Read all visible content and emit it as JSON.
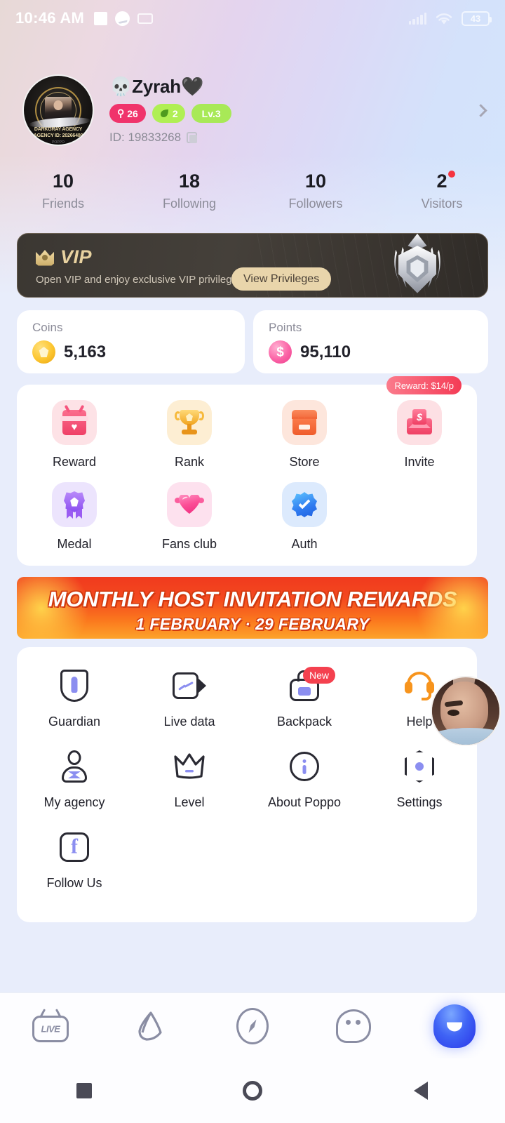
{
  "status_bar": {
    "time": "10:46 AM",
    "battery_percent": "43",
    "icons": [
      "square-icon",
      "messenger-icon",
      "card-icon",
      "signal-icon",
      "wifi-icon",
      "battery-icon"
    ]
  },
  "profile": {
    "name": "💀Zyrah🖤",
    "avatar": {
      "agency_line1": "DARKGRAY AGENCY",
      "agency_line2": "AGENCY ID: 20266400",
      "agency_line3": "POPPO"
    },
    "badges": [
      {
        "name": "gender-age-badge",
        "label": "26",
        "color": "#f0336b"
      },
      {
        "name": "leaf-badge",
        "label": "2",
        "color": "#b0ef54"
      },
      {
        "name": "level-badge",
        "label": "Lv.3",
        "color": "#a8e957"
      }
    ],
    "id_label": "ID: 19833268",
    "chevron": "chevron-right-icon"
  },
  "stats": [
    {
      "value": "10",
      "label": "Friends",
      "dot": false
    },
    {
      "value": "18",
      "label": "Following",
      "dot": false
    },
    {
      "value": "10",
      "label": "Followers",
      "dot": false
    },
    {
      "value": "2",
      "label": "Visitors",
      "dot": true
    }
  ],
  "vip": {
    "title": "VIP",
    "subtitle": "Open VIP and enjoy exclusive VIP privileges",
    "button": "View Privileges"
  },
  "wallet": {
    "coins": {
      "label": "Coins",
      "value": "5,163"
    },
    "points": {
      "label": "Points",
      "value": "95,110"
    }
  },
  "quick_grid": [
    {
      "label": "Reward",
      "icon": "gift-icon"
    },
    {
      "label": "Rank",
      "icon": "trophy-icon"
    },
    {
      "label": "Store",
      "icon": "store-icon"
    },
    {
      "label": "Invite",
      "icon": "envelope-money-icon",
      "badge": "Reward: $14/p"
    },
    {
      "label": "Medal",
      "icon": "medal-icon"
    },
    {
      "label": "Fans club",
      "icon": "heart-icon"
    },
    {
      "label": "Auth",
      "icon": "verified-check-icon"
    }
  ],
  "promo_banner": {
    "title": "MONTHLY HOST INVITATION REWARDS",
    "subtitle": "1 FEBRUARY · 29 FEBRUARY"
  },
  "menu": [
    {
      "label": "Guardian",
      "icon": "shield-icon"
    },
    {
      "label": "Live data",
      "icon": "video-chart-icon"
    },
    {
      "label": "Backpack",
      "icon": "backpack-icon",
      "badge": "New"
    },
    {
      "label": "Help",
      "icon": "headset-icon"
    },
    {
      "label": "My agency",
      "icon": "agent-person-icon"
    },
    {
      "label": "Level",
      "icon": "crown-icon"
    },
    {
      "label": "About Poppo",
      "icon": "info-icon"
    },
    {
      "label": "Settings",
      "icon": "hexagon-settings-icon"
    },
    {
      "label": "Follow Us",
      "icon": "facebook-icon"
    }
  ],
  "bottom_nav": [
    {
      "name": "live",
      "icon": "live-tv-icon",
      "active": false
    },
    {
      "name": "moments",
      "icon": "cone-icon",
      "active": false
    },
    {
      "name": "discover",
      "icon": "compass-icon",
      "active": false
    },
    {
      "name": "messages",
      "icon": "ghost-chat-icon",
      "active": false
    },
    {
      "name": "me",
      "icon": "profile-avatar-icon",
      "active": true
    }
  ],
  "android_nav": [
    "recents-button",
    "home-button",
    "back-button"
  ]
}
